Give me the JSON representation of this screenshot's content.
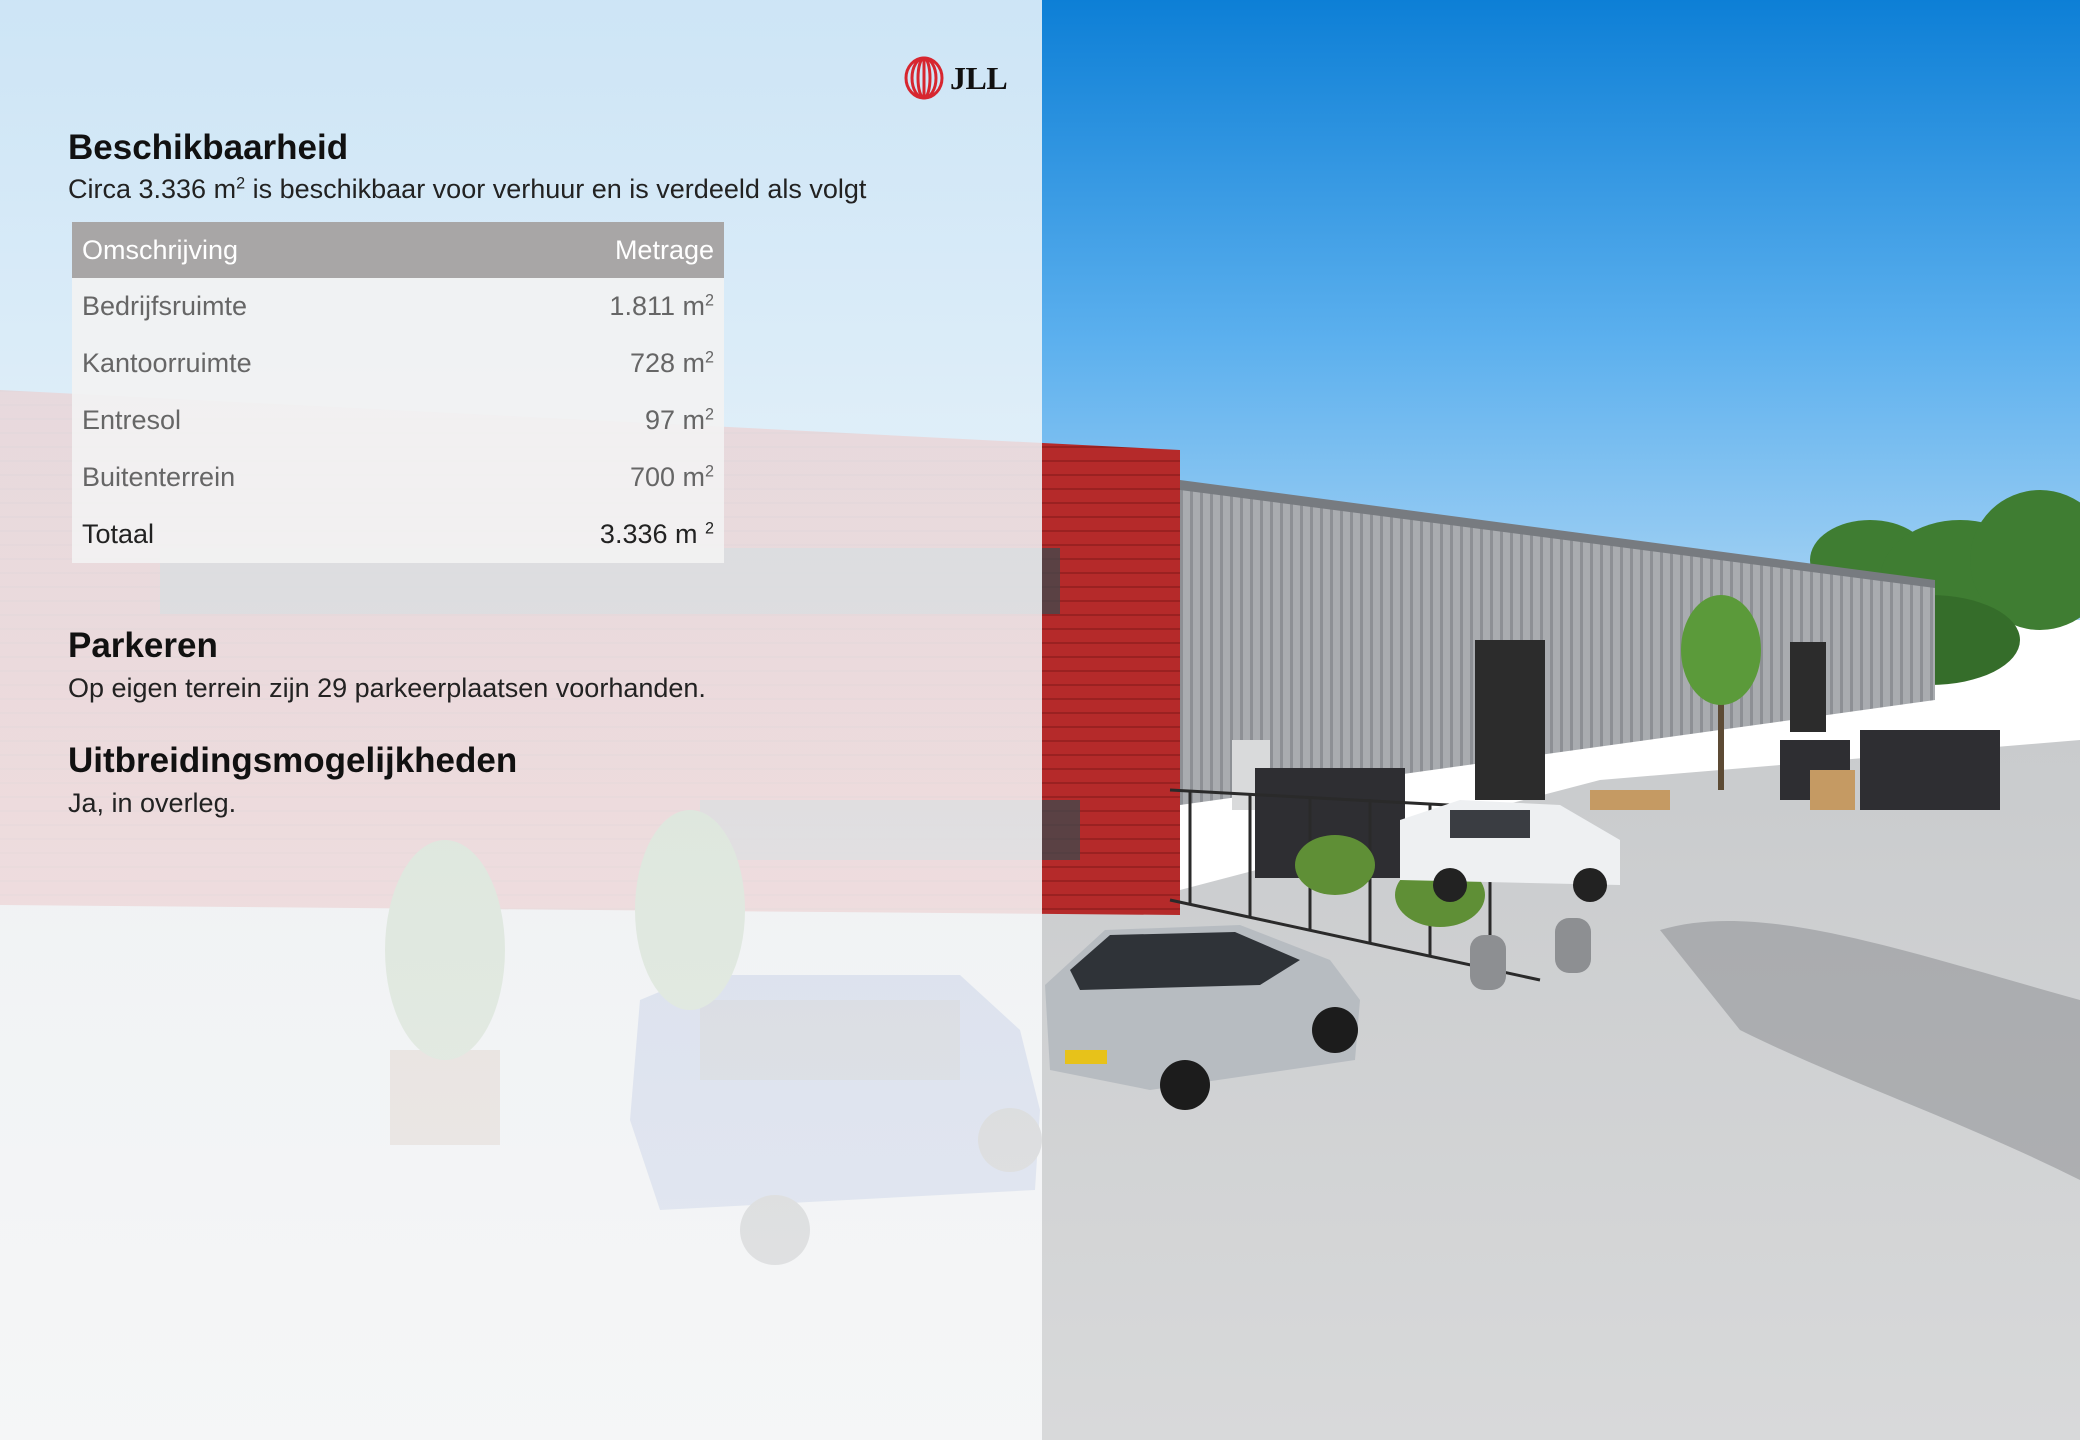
{
  "brand": {
    "name": "JLL",
    "color": "#d7262f"
  },
  "availability": {
    "heading": "Beschikbaarheid",
    "intro_prefix": "Circa 3.336 m",
    "intro_sup": "2",
    "intro_suffix": " is beschikbaar voor verhuur en is verdeeld als volgt",
    "table": {
      "col_description": "Omschrijving",
      "col_area": "Metrage",
      "rows": [
        {
          "label": "Bedrijfsruimte",
          "value": "1.811 m",
          "unit_sup": "2"
        },
        {
          "label": "Kantoorruimte",
          "value": "728 m",
          "unit_sup": "2"
        },
        {
          "label": "Entresol",
          "value": "97 m",
          "unit_sup": "2"
        },
        {
          "label": "Buitenterrein",
          "value": "700 m",
          "unit_sup": "2"
        }
      ],
      "total": {
        "label": "Totaal",
        "value": "3.336 m ",
        "unit_sup": "2"
      }
    }
  },
  "parking": {
    "heading": "Parkeren",
    "text": "Op eigen terrein zijn 29 parkeerplaatsen voorhanden."
  },
  "expansion": {
    "heading": "Uitbreidingsmogelijkheden",
    "text": "Ja, in overleg."
  },
  "colors": {
    "table_header": "#a8a6a6",
    "facade_red": "#b82d2c",
    "sky_blue": "#1f8fdc"
  }
}
